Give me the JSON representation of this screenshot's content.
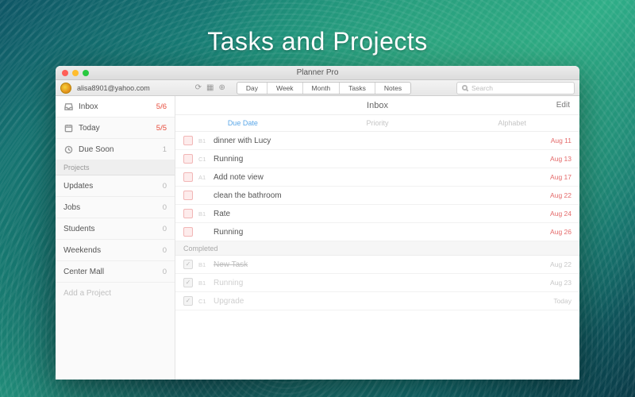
{
  "caption": "Tasks and Projects",
  "window_title": "Planner Pro",
  "user_email": "alisa8901@yahoo.com",
  "view_tabs": [
    "Day",
    "Week",
    "Month",
    "Tasks",
    "Notes"
  ],
  "view_active": "Tasks",
  "search_placeholder": "Search",
  "sidebar": {
    "smart": [
      {
        "icon": "inbox",
        "label": "Inbox",
        "count": "5/6",
        "count_cls": "cnt-red",
        "selected": true
      },
      {
        "icon": "calendar",
        "label": "Today",
        "count": "5/5",
        "count_cls": "cnt-red"
      },
      {
        "icon": "clock",
        "label": "Due Soon",
        "count": "1",
        "count_cls": "cnt-gray"
      }
    ],
    "projects_header": "Projects",
    "projects": [
      {
        "label": "Updates",
        "count": "0"
      },
      {
        "label": "Jobs",
        "count": "0"
      },
      {
        "label": "Students",
        "count": "0"
      },
      {
        "label": "Weekends",
        "count": "0"
      },
      {
        "label": "Center Mall",
        "count": "0"
      }
    ],
    "add_project": "Add a Project"
  },
  "main": {
    "title": "Inbox",
    "edit": "Edit",
    "sort_tabs": [
      "Due Date",
      "Priority",
      "Alphabet"
    ],
    "sort_active": "Due Date",
    "tasks": [
      {
        "prio": "B1",
        "title": "dinner with Lucy",
        "date": "Aug 11"
      },
      {
        "prio": "C1",
        "title": "Running",
        "date": "Aug 13"
      },
      {
        "prio": "A1",
        "title": "Add note view",
        "date": "Aug 17"
      },
      {
        "prio": "",
        "title": "clean the bathroom",
        "date": "Aug 22"
      },
      {
        "prio": "B1",
        "title": "Rate",
        "date": "Aug 24"
      },
      {
        "prio": "",
        "title": "Running",
        "date": "Aug 26"
      }
    ],
    "completed_header": "Completed",
    "completed": [
      {
        "prio": "B1",
        "title": "New Task",
        "date": "Aug 22",
        "strike": true
      },
      {
        "prio": "B1",
        "title": "Running",
        "date": "Aug 23",
        "faded": true
      },
      {
        "prio": "C1",
        "title": "Upgrade",
        "date": "Today",
        "faded": true
      }
    ]
  }
}
